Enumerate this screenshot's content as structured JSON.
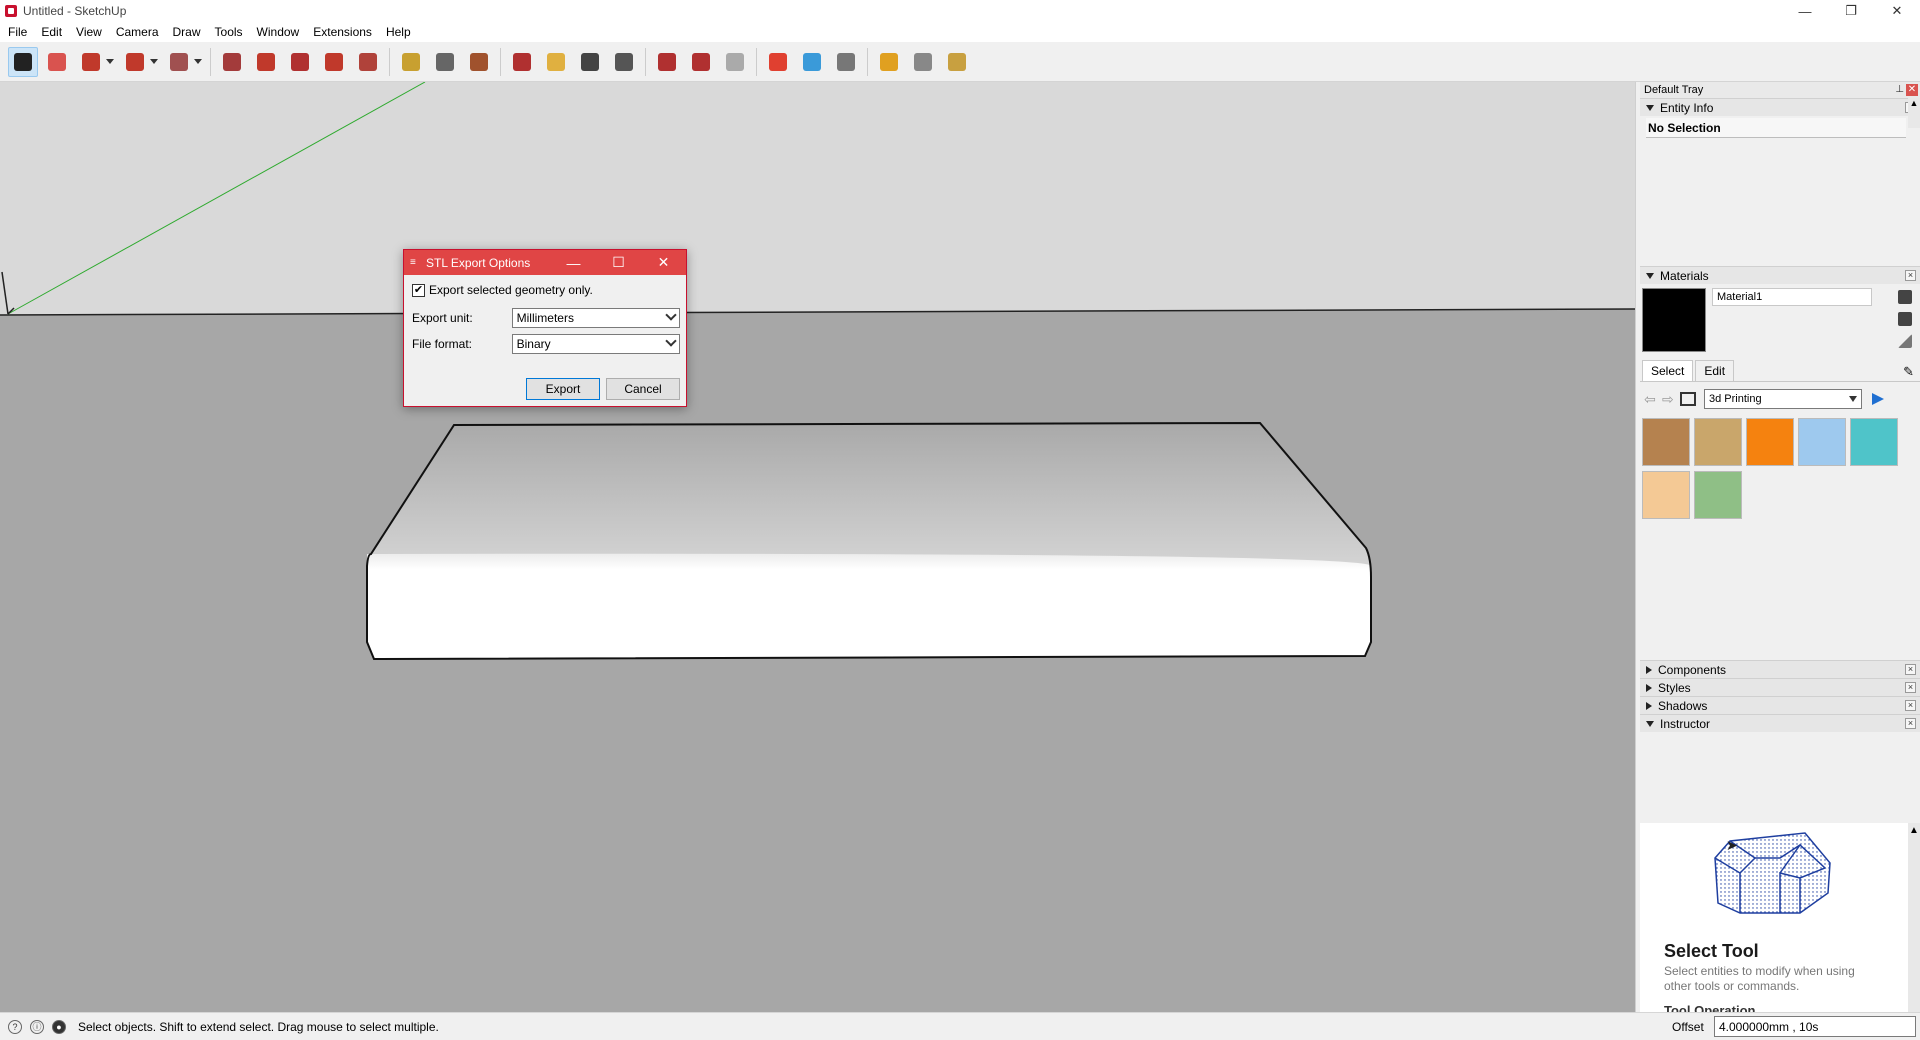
{
  "window": {
    "title": "Untitled - SketchUp",
    "controls": [
      "—",
      "❐",
      "✕"
    ]
  },
  "menu": [
    "File",
    "Edit",
    "View",
    "Camera",
    "Draw",
    "Tools",
    "Window",
    "Extensions",
    "Help"
  ],
  "toolbar": {
    "tools": [
      {
        "name": "select-tool",
        "color": "#222222",
        "active": true
      },
      {
        "name": "eraser-tool",
        "color": "#d9534f"
      },
      {
        "name": "pencil-tool",
        "color": "#c0392b",
        "dropdown": true
      },
      {
        "name": "arc-tool",
        "color": "#c0392b",
        "dropdown": true
      },
      {
        "name": "rectangle-tool",
        "color": "#a05050",
        "dropdown": true
      },
      {
        "name": "push-pull-tool",
        "color": "#a33b3b"
      },
      {
        "name": "offset-tool",
        "color": "#c0392b"
      },
      {
        "name": "move-tool",
        "color": "#b03030"
      },
      {
        "name": "rotate-tool",
        "color": "#c0392b"
      },
      {
        "name": "scale-tool",
        "color": "#b0423a"
      },
      {
        "name": "tape-measure-tool",
        "color": "#c8a030"
      },
      {
        "name": "text-tool",
        "color": "#666666"
      },
      {
        "name": "paint-bucket-tool",
        "color": "#a0522d"
      },
      {
        "name": "orbit-tool",
        "color": "#b03030"
      },
      {
        "name": "pan-tool",
        "color": "#e0b040"
      },
      {
        "name": "zoom-tool",
        "color": "#444444"
      },
      {
        "name": "zoom-extents-tool",
        "color": "#555555"
      },
      {
        "name": "warehouse-icon",
        "color": "#b03030"
      },
      {
        "name": "extension-warehouse-icon",
        "color": "#b03030"
      },
      {
        "name": "layout-icon",
        "color": "#aaaaaa"
      },
      {
        "name": "front-view-icon",
        "color": "#e04030"
      },
      {
        "name": "top-view-icon",
        "color": "#3a9ad9"
      },
      {
        "name": "right-view-icon",
        "color": "#777777"
      },
      {
        "name": "solid-union-icon",
        "color": "#e0a020"
      },
      {
        "name": "solid-subtract-icon",
        "color": "#888888"
      },
      {
        "name": "solid-trim-icon",
        "color": "#c8a040"
      }
    ]
  },
  "dialog": {
    "title": "STL Export Options",
    "checkbox_label": "Export selected geometry only.",
    "checkbox_mark": "✔",
    "export_unit_label": "Export unit:",
    "export_unit_value": "Millimeters",
    "file_format_label": "File format:",
    "file_format_value": "Binary",
    "export_button": "Export",
    "cancel_button": "Cancel",
    "controls": [
      "—",
      "☐",
      "✕"
    ]
  },
  "tray": {
    "title": "Default Tray",
    "close": "✕",
    "entity_info": {
      "header": "Entity Info",
      "value": "No Selection"
    },
    "materials": {
      "header": "Materials",
      "name_value": "Material1",
      "tabs": [
        "Select",
        "Edit"
      ],
      "library": "3d Printing",
      "swatch_color": "#000000",
      "swatches": [
        "#b5824f",
        "#c9a66b",
        "#f5820f",
        "#9ec9ee",
        "#4fc4c9",
        "#f4c995",
        "#8fbf86"
      ]
    },
    "collapsed_panels": [
      "Components",
      "Styles",
      "Shadows"
    ],
    "instructor": {
      "header": "Instructor",
      "title": "Select Tool",
      "text": "Select entities to modify when using other tools or commands.",
      "operation": "Tool Operation"
    },
    "panel_close": "×"
  },
  "status": {
    "text": "Select objects. Shift to extend select. Drag mouse to select multiple.",
    "offset_label": "Offset",
    "offset_value": "4.000000mm , 10s",
    "icons": [
      "?",
      "ⓘ",
      "●"
    ]
  },
  "colors": {
    "sky": "#d9d9d9",
    "ground": "#a7a7a7",
    "dialog_title": "#e04545",
    "green_axis": "#2eaa2e"
  }
}
